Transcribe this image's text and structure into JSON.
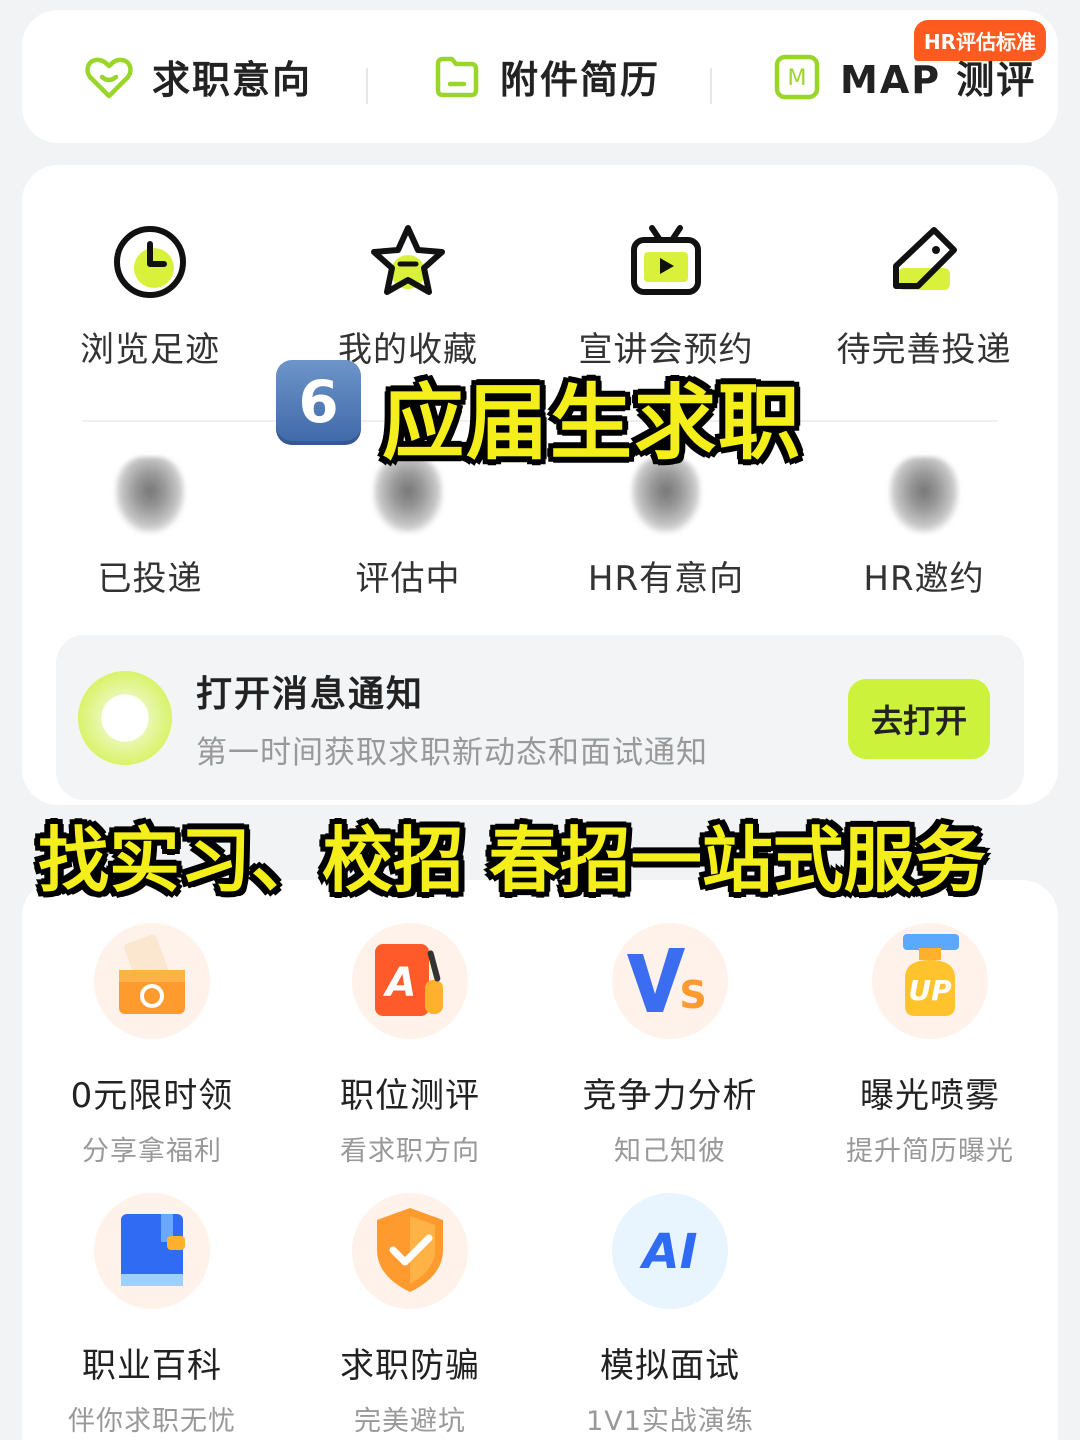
{
  "topbar": {
    "items": [
      {
        "label": "求职意向",
        "icon": "heart-icon"
      },
      {
        "label": "附件简历",
        "icon": "folder-icon"
      },
      {
        "label": "MAP 测评",
        "icon": "m-square-icon"
      }
    ],
    "badge": "HR评估标准",
    "accent": "#9ad62a"
  },
  "quick_links": [
    {
      "label": "浏览足迹",
      "icon": "clock-icon"
    },
    {
      "label": "我的收藏",
      "icon": "star-icon"
    },
    {
      "label": "宣讲会预约",
      "icon": "tv-icon"
    },
    {
      "label": "待完善投递",
      "icon": "tag-icon"
    }
  ],
  "status": [
    {
      "label": "已投递"
    },
    {
      "label": "评估中"
    },
    {
      "label": "HR有意向"
    },
    {
      "label": "HR邀约"
    }
  ],
  "notification": {
    "title": "打开消息通知",
    "subtitle": "第一时间获取求职新动态和面试通知",
    "button": "去打开",
    "button_color": "#cdf23b"
  },
  "tools": [
    {
      "label": "0元限时领",
      "sub": "分享拿福利",
      "icon": "gift-box-icon"
    },
    {
      "label": "职位测评",
      "sub": "看求职方向",
      "icon": "a-grade-icon"
    },
    {
      "label": "竞争力分析",
      "sub": "知己知彼",
      "icon": "vs-icon"
    },
    {
      "label": "曝光喷雾",
      "sub": "提升简历曝光",
      "icon": "up-spray-icon"
    },
    {
      "label": "职业百科",
      "sub": "伴你求职无忧",
      "icon": "book-icon"
    },
    {
      "label": "求职防骗",
      "sub": "完美避坑",
      "icon": "shield-icon"
    },
    {
      "label": "模拟面试",
      "sub": "1V1实战演练",
      "icon": "ai-icon"
    }
  ],
  "overlay": {
    "number": "6",
    "title": "应届生求职",
    "subtitle": "找实习、校招 春招一站式服务"
  }
}
